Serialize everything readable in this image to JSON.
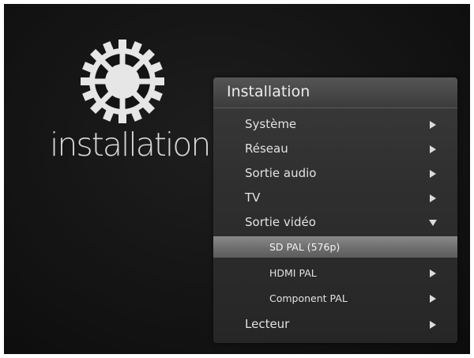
{
  "panel": {
    "title": "Installation"
  },
  "branding": {
    "label": "installation",
    "icon": "gear-icon"
  },
  "menu": {
    "items": [
      {
        "label": "Système",
        "indicator": "arrow-right-icon"
      },
      {
        "label": "Réseau",
        "indicator": "arrow-right-icon"
      },
      {
        "label": "Sortie audio",
        "indicator": "arrow-right-icon"
      },
      {
        "label": "TV",
        "indicator": "arrow-right-icon"
      },
      {
        "label": "Sortie vidéo",
        "indicator": "arrow-down-icon",
        "expanded": true
      },
      {
        "label": "SD PAL (576p)",
        "indicator": "",
        "selected": true
      },
      {
        "label": "HDMI PAL",
        "indicator": "arrow-right-icon"
      },
      {
        "label": "Component PAL",
        "indicator": "arrow-right-icon"
      },
      {
        "label": "Lecteur",
        "indicator": "arrow-right-icon"
      }
    ]
  },
  "colors": {
    "background": "#141414",
    "panel": "#2f2f2f",
    "highlight": "#7a7a7a",
    "text": "#e2e2e2"
  }
}
